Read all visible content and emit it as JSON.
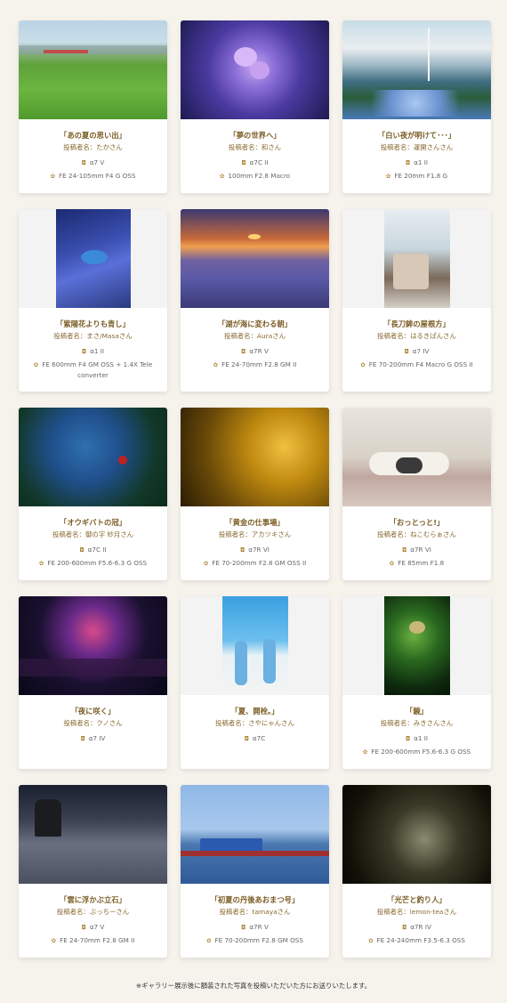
{
  "cards": [
    {
      "title": "「あの夏の思い出」",
      "author": "投稿者名：たかさん",
      "camera": "α7 V",
      "lens": "FE 24-105mm F4 G OSS"
    },
    {
      "title": "「夢の世界へ」",
      "author": "投稿者名：和さん",
      "camera": "α7C II",
      "lens": "100mm F2.8 Macro"
    },
    {
      "title": "「白い夜が明けて･･･」",
      "author": "投稿者名：運開さんさん",
      "camera": "α1 II",
      "lens": "FE 20mm F1.8 G"
    },
    {
      "title": "「紫陽花よりも青し」",
      "author": "投稿者名：まさ/Masaさん",
      "camera": "α1 II",
      "lens": "FE 600mm F4 GM OSS + 1.4X Tele converter"
    },
    {
      "title": "「湖が海に変わる朝」",
      "author": "投稿者名：Auraさん",
      "camera": "α7R V",
      "lens": "FE 24-70mm F2.8 GM II"
    },
    {
      "title": "「長刀鉾の屋根方」",
      "author": "投稿者名：はるきぱんさん",
      "camera": "α7 IV",
      "lens": "FE 70-200mm F4 Macro G OSS II"
    },
    {
      "title": "「オウギバトの冠」",
      "author": "投稿者名：御の字 紗月さん",
      "camera": "α7C II",
      "lens": "FE 200-600mm F5.6-6.3 G OSS"
    },
    {
      "title": "「黄金の仕事場」",
      "author": "投稿者名：アカツキさん",
      "camera": "α7R VI",
      "lens": "FE 70-200mm F2.8 GM OSS II"
    },
    {
      "title": "「おっとっと!」",
      "author": "投稿者名：ねこむらぁさん",
      "camera": "α7R VI",
      "lens": "FE 85mm F1.8"
    },
    {
      "title": "「夜に咲く」",
      "author": "投稿者名：クノさん",
      "camera": "α7 IV",
      "lens": ""
    },
    {
      "title": "「夏、開栓。」",
      "author": "投稿者名：さやにゃんさん",
      "camera": "α7C",
      "lens": ""
    },
    {
      "title": "「鏡」",
      "author": "投稿者名：みきさんさん",
      "camera": "α1 II",
      "lens": "FE 200-600mm F5.6-6.3 G OSS"
    },
    {
      "title": "「雲に浮かぶ立石」",
      "author": "投稿者名：ぶっちーさん",
      "camera": "α7 V",
      "lens": "FE 24-70mm F2.8 GM II"
    },
    {
      "title": "「初夏の丹後あおまつ号」",
      "author": "投稿者名：tamayaさん",
      "camera": "α7R V",
      "lens": "FE 70-200mm F2.8 GM OSS"
    },
    {
      "title": "「光芒と釣り人」",
      "author": "投稿者名：lemon-teaさん",
      "camera": "α7R IV",
      "lens": "FE 24-240mm F3.5-6.3 OSS"
    }
  ],
  "icons": {
    "camera": "camera-icon",
    "lens": "lens-icon"
  },
  "footnote": "※ギャラリー展示後に額装された写真を投稿いただいた方にお送りいたします。"
}
